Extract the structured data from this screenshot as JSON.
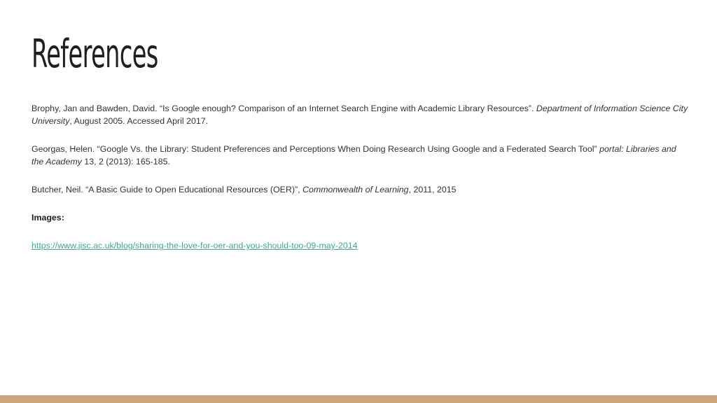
{
  "slide": {
    "title": "References",
    "references": [
      {
        "pre": "Brophy, Jan and Bawden, David. “Is Google enough? Comparison of an Internet Search Engine with Academic Library Resources”. ",
        "em": "Department of Information Science City University",
        "post": ", August 2005. Accessed April 2017."
      },
      {
        "pre": "Georgas, Helen. “Google Vs. the Library: Student Preferences and Perceptions When Doing Research Using Google and a Federated Search Tool” ",
        "em": "portal: Libraries and the Academy",
        "post": " 13, 2 (2013): 165-185."
      },
      {
        "pre": "Butcher, Neil. “A Basic Guide to Open Educational Resources (OER)”, ",
        "em": "Commonwealth of Learning",
        "post": ", 2011, 2015"
      }
    ],
    "images_label": "Images:",
    "image_link": "https://www.jisc.ac.uk/blog/sharing-the-love-for-oer-and-you-should-too-09-may-2014"
  },
  "colors": {
    "link": "#3fa98f",
    "footer_band": "#c9a67b"
  }
}
